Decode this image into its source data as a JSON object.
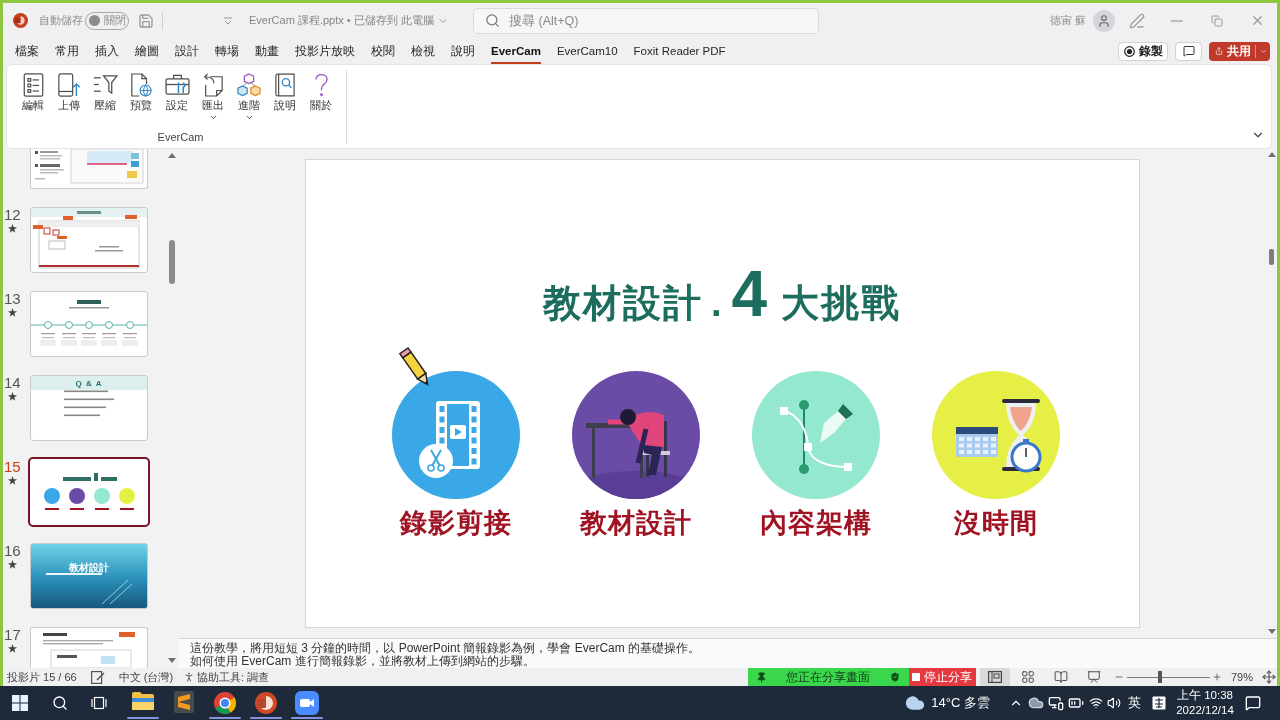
{
  "title_bar": {
    "autosave": {
      "label": "自動儲存",
      "state_label": "關閉",
      "on": false
    },
    "file_name": "EverCam 課程.pptx • 已儲存到 此電腦",
    "search": {
      "placeholder": "搜尋 (Alt+Q)"
    },
    "user_name": "德宙 蘇"
  },
  "ribbon_tabs": [
    {
      "label": "檔案",
      "selected": false
    },
    {
      "label": "常用",
      "selected": false
    },
    {
      "label": "插入",
      "selected": false
    },
    {
      "label": "繪圖",
      "selected": false
    },
    {
      "label": "設計",
      "selected": false
    },
    {
      "label": "轉場",
      "selected": false
    },
    {
      "label": "動畫",
      "selected": false
    },
    {
      "label": "投影片放映",
      "selected": false
    },
    {
      "label": "校閱",
      "selected": false
    },
    {
      "label": "檢視",
      "selected": false
    },
    {
      "label": "說明",
      "selected": false
    },
    {
      "label": "EverCam",
      "selected": true
    },
    {
      "label": "EverCam10",
      "selected": false
    },
    {
      "label": "Foxit Reader PDF",
      "selected": false
    }
  ],
  "ribbon_actions": {
    "record": "錄製",
    "share": "共用"
  },
  "ribbon": {
    "group_label": "EverCam",
    "buttons": [
      {
        "label": "編輯",
        "menu": false
      },
      {
        "label": "上傳",
        "menu": false
      },
      {
        "label": "壓縮",
        "menu": false
      },
      {
        "label": "預覽",
        "menu": false
      },
      {
        "label": "設定",
        "menu": false
      },
      {
        "label": "匯出",
        "menu": true
      },
      {
        "label": "進階",
        "menu": true
      },
      {
        "label": "說明",
        "menu": false
      },
      {
        "label": "關於",
        "menu": false
      }
    ]
  },
  "thumbnails": [
    {
      "kind": "screenshot",
      "animated": false,
      "selected": false
    },
    {
      "number": "12",
      "kind": "annotated",
      "animated": true,
      "selected": false
    },
    {
      "number": "13",
      "kind": "timeline",
      "animated": true,
      "selected": false
    },
    {
      "number": "14",
      "kind": "qa",
      "title": "Q & A",
      "animated": true,
      "selected": false
    },
    {
      "number": "15",
      "kind": "challenges",
      "animated": true,
      "selected": true
    },
    {
      "number": "16",
      "kind": "section",
      "title": "教材設計",
      "animated": true,
      "selected": false
    },
    {
      "number": "17",
      "kind": "document",
      "animated": true,
      "selected": false
    }
  ],
  "slide": {
    "title": "教材設計",
    "title_dot": ".",
    "title_number": "4",
    "title_suffix": "大挑戰",
    "challenges": [
      {
        "kind": "video-editing",
        "label": "錄影剪接",
        "color": "#3aa8e6"
      },
      {
        "kind": "tired",
        "label": "教材設計",
        "color": "#6a4ca6"
      },
      {
        "kind": "structure",
        "label": "內容架構",
        "color": "#93e8cf"
      },
      {
        "kind": "time",
        "label": "沒時間",
        "color": "#e5ef45"
      }
    ]
  },
  "notes": [
    "這份教學，將用短短 3 分鐘的時間，以 PowerPoint 簡報錄影為例，學會 EverCam 的基礎操作。",
    "如何使用 EverCam 進行簡報錄影，並將教材上傳到網站的步驟。"
  ],
  "status_bar": {
    "slide_counter": "投影片 15 / 66",
    "language": "中文 (台灣)",
    "accessibility": "協助工具: 調查",
    "sharing": {
      "message": "您正在分享畫面",
      "stop": "停止分享"
    },
    "views": [
      {
        "selected": true
      },
      {
        "selected": false
      },
      {
        "selected": false
      },
      {
        "selected": false
      }
    ],
    "zoom": {
      "level": 0.4,
      "reading": "79%"
    }
  },
  "taskbar": {
    "apps": [
      {
        "running": true
      },
      {
        "running": false
      },
      {
        "running": true
      },
      {
        "running": true
      },
      {
        "running": true
      }
    ],
    "weather": "14°C 多雲",
    "input_mode": "英",
    "time": "上午 10:38",
    "date": "2022/12/14"
  }
}
